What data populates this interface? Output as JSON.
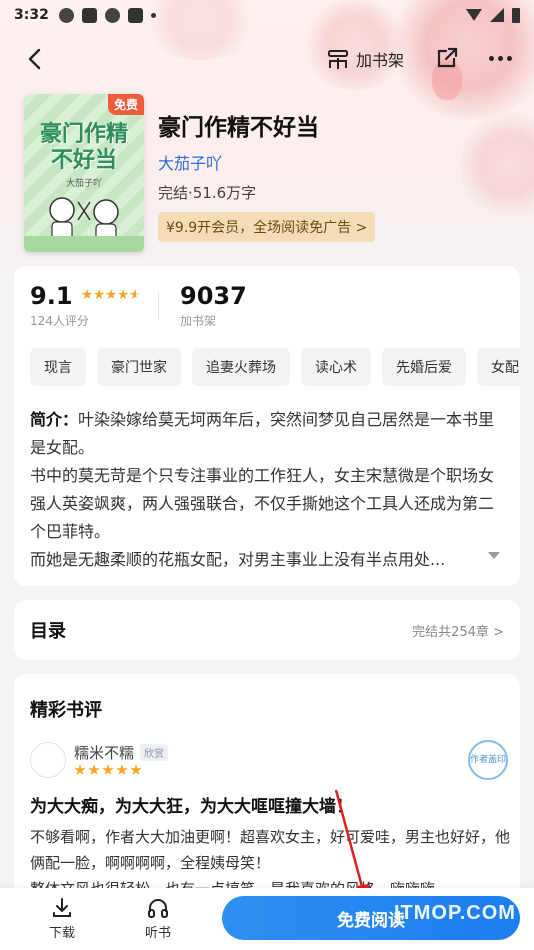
{
  "status_bar": {
    "time": "3:32"
  },
  "nav": {
    "shelf_label": "加书架"
  },
  "book": {
    "cover_badge": "免费",
    "cover_title": "豪门作精不好当",
    "cover_author": "大茄子吖",
    "title": "豪门作精不好当",
    "author": "大茄子吖",
    "status": "完结·51.6万字",
    "vip_banner": "¥9.9开会员，全场阅读免广告 >"
  },
  "stats": {
    "rating": "9.1",
    "rating_count": "124人评分",
    "shelf_count": "9037",
    "shelf_label": "加书架"
  },
  "tags": [
    "现言",
    "豪门世家",
    "追妻火葬场",
    "读心术",
    "先婚后爱",
    "女配"
  ],
  "intro": {
    "label": "简介：",
    "lines": [
      "叶染染嫁给莫无坷两年后，突然间梦见自己居然是一本书里是女配。",
      "书中的莫无苛是个只专注事业的工作狂人，女主宋慧微是个职场女强人英姿飒爽，两人强强联合，不仅手撕她这个工具人还成为第二个巴菲特。",
      "而她是无趣柔顺的花瓶女配，对男主事业上没有半点用处..."
    ]
  },
  "toc": {
    "title": "目录",
    "meta": "完结共254章 >"
  },
  "reviews": {
    "title": "精彩书评",
    "items": [
      {
        "user": "糯米不糯",
        "badge": "欣赏",
        "seal": "作者盖印",
        "headline": "为大大痴，为大大狂，为大大哐哐撞大墙！",
        "body": "不够看啊，作者大大加油更啊！超喜欢女主，好可爱哇，男主也好好，他俩配一脸，啊啊啊啊，全程姨母笑！\n整体文风也很轻松，也有一点搞笑，是我喜欢的风格，嗨嗨嗨，"
      }
    ]
  },
  "bottom_bar": {
    "download_label": "下载",
    "listen_label": "听书",
    "read_label": "免费阅读"
  },
  "watermark": "ITMOP.COM",
  "colors": {
    "accent": "#1f82f0",
    "star": "#f5a623",
    "vip_bg": "#f3dcb6"
  }
}
